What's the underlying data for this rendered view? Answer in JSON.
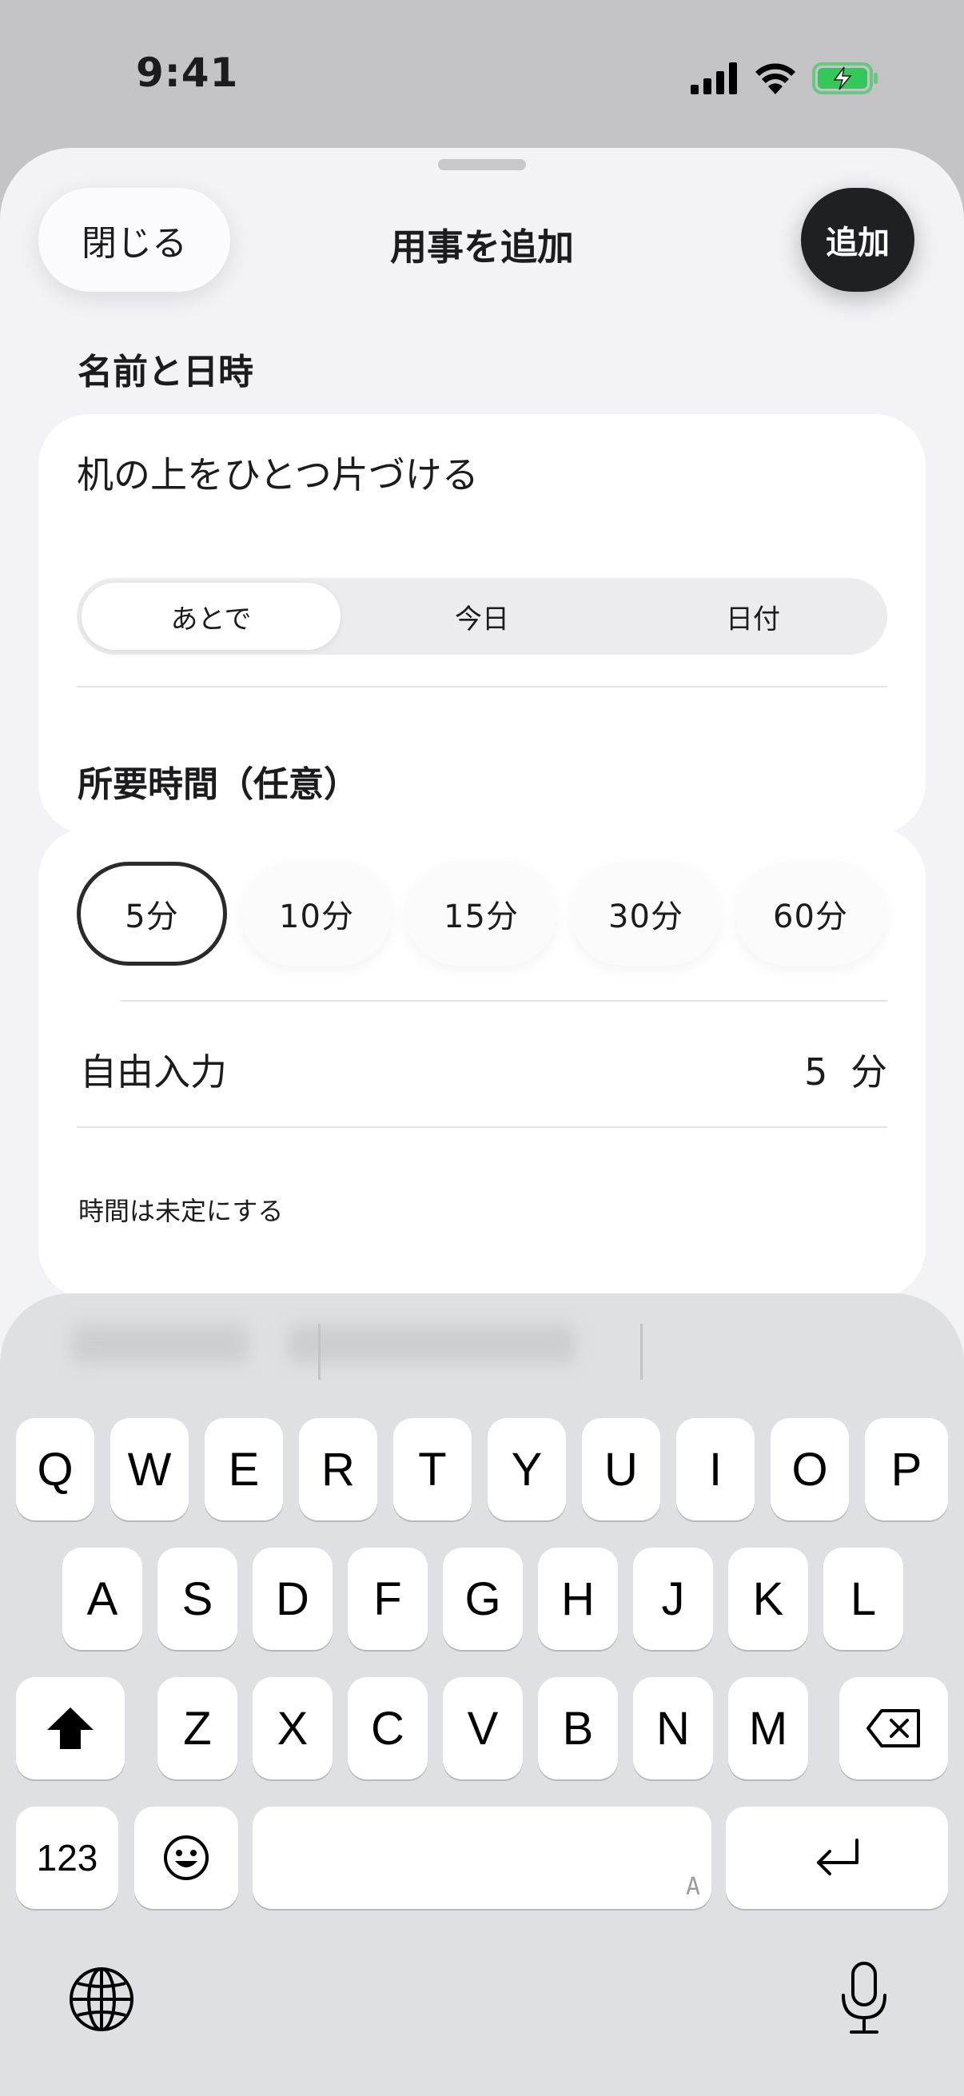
{
  "status_bar": {
    "time": "9:41"
  },
  "sheet": {
    "close_label": "閉じる",
    "title": "用事を追加",
    "add_label": "追加"
  },
  "name_section": {
    "label": "名前と日時",
    "name_value": "机の上をひとつ片づける",
    "segments": [
      {
        "label": "あとで",
        "selected": true
      },
      {
        "label": "今日",
        "selected": false
      },
      {
        "label": "日付",
        "selected": false
      }
    ]
  },
  "duration_section": {
    "label": "所要時間（任意）",
    "chips": [
      {
        "label": "5分",
        "selected": true
      },
      {
        "label": "10分",
        "selected": false
      },
      {
        "label": "15分",
        "selected": false
      },
      {
        "label": "30分",
        "selected": false
      },
      {
        "label": "60分",
        "selected": false
      }
    ],
    "free_input_label": "自由入力",
    "free_input_value": "5 分",
    "unset_label": "時間は未定にする"
  },
  "keyboard": {
    "row1": [
      "Q",
      "W",
      "E",
      "R",
      "T",
      "Y",
      "U",
      "I",
      "O",
      "P"
    ],
    "row2": [
      "A",
      "S",
      "D",
      "F",
      "G",
      "H",
      "J",
      "K",
      "L"
    ],
    "row3": [
      "Z",
      "X",
      "C",
      "V",
      "B",
      "N",
      "M"
    ],
    "numbers_label": "123",
    "space_hint": "A",
    "icons": {
      "shift": "shift-icon",
      "delete": "delete-icon",
      "emoji": "emoji-icon",
      "return": "return-icon",
      "globe": "globe-icon",
      "mic": "microphone-icon"
    }
  },
  "colors": {
    "accent_dark": "#1f2023",
    "sheet_bg": "#f2f2f7",
    "keyboard_bg": "#dfe0e4",
    "battery_green": "#34c759"
  }
}
